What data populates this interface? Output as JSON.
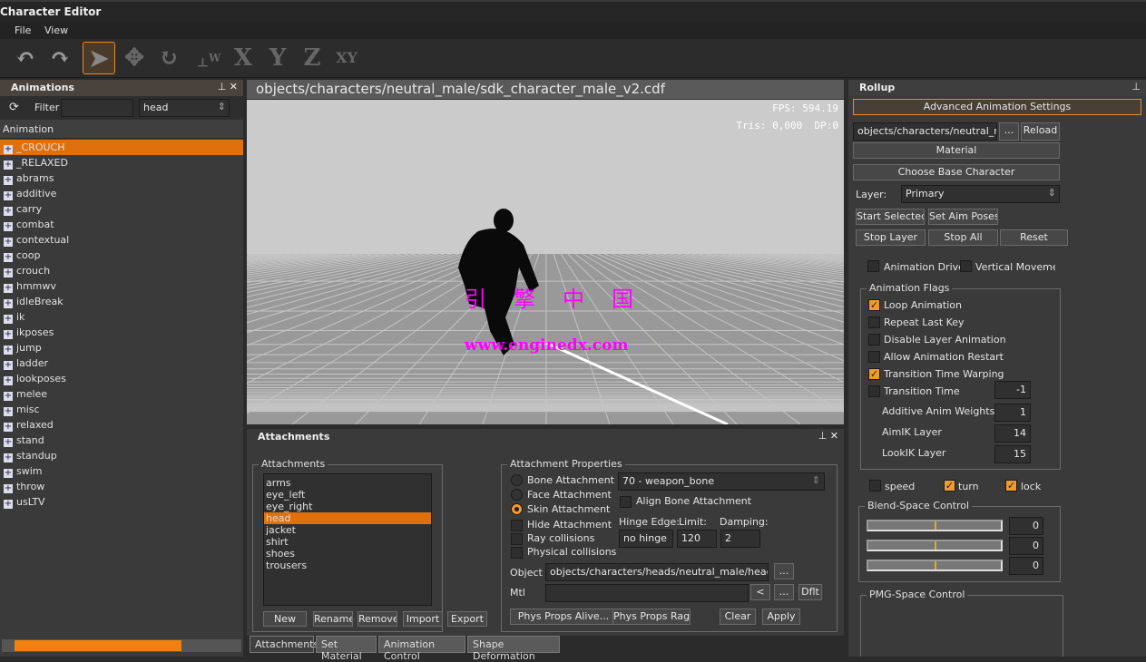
{
  "app": {
    "title": "Character Editor",
    "menu": [
      "File",
      "View"
    ]
  },
  "toolbar": {
    "icons": [
      "undo-icon",
      "redo-icon",
      "select-arrow-icon",
      "move-icon",
      "rotate-icon",
      "world-axis-icon"
    ],
    "axis_buttons": [
      "X",
      "Y",
      "Z",
      "XY"
    ],
    "world_label": "W"
  },
  "animations": {
    "title": "Animations",
    "filter_label": "Filter",
    "filter_value": "",
    "combo_value": "head",
    "column": "Animation",
    "items": [
      "_CROUCH",
      "_RELAXED",
      "abrams",
      "additive",
      "carry",
      "combat",
      "contextual",
      "coop",
      "crouch",
      "hmmwv",
      "idleBreak",
      "ik",
      "ikposes",
      "jump",
      "ladder",
      "lookposes",
      "melee",
      "misc",
      "relaxed",
      "stand",
      "standup",
      "swim",
      "throw",
      "usLTV"
    ],
    "selected": "_CROUCH",
    "scroll_fraction": 0.68
  },
  "viewport": {
    "path": "objects/characters/neutral_male/sdk_character_male_v2.cdf",
    "fps": "FPS: 594.19",
    "tris": "Tris: 0,000  DP:0",
    "watermark_cn": "引擎中国",
    "watermark_url": "www.enginedx.com"
  },
  "attachments": {
    "title": "Attachments",
    "list_title": "Attachments",
    "items": [
      "arms",
      "eye_left",
      "eye_right",
      "head",
      "jacket",
      "shirt",
      "shoes",
      "trousers"
    ],
    "selected": "head",
    "buttons": [
      "New",
      "Rename",
      "Remove",
      "Import",
      "Export"
    ],
    "props": {
      "title": "Attachment Properties",
      "radios": [
        {
          "label": "Bone Attachment",
          "on": false
        },
        {
          "label": "Face Attachment",
          "on": false
        },
        {
          "label": "Skin Attachment",
          "on": true
        }
      ],
      "checks": [
        "Hide Attachment",
        "Ray collisions",
        "Physical collisions"
      ],
      "bone": "70 - weapon_bone",
      "align": "Align Bone Attachment",
      "hinge_label": "Hinge Edge:",
      "hinge": "no hinge",
      "limit_label": "Limit:",
      "limit": "120",
      "damping_label": "Damping:",
      "damping": "2",
      "object_label": "Object",
      "object": "objects/characters/heads/neutral_male/head.chr",
      "browse": "...",
      "mtl_label": "Mtl",
      "mtl": "",
      "lt": "<",
      "dflt": "Dflt",
      "buttons": [
        "Phys Props Alive...",
        "Phys Props Ragdoll...",
        "Clear",
        "Apply"
      ]
    }
  },
  "bottom_tabs": [
    "Attachments",
    "Set Material",
    "Animation Control",
    "Shape Deformation"
  ],
  "rollup": {
    "title": "Rollup",
    "section": "Advanced Animation Settings",
    "path": "objects/characters/neutral_mal",
    "browse": "...",
    "reload": "Reload",
    "material": "Material",
    "choose_base": "Choose Base Character",
    "layer_label": "Layer:",
    "layer": "Primary",
    "buttons": [
      "Start Selected",
      "Set Aim Poses",
      "Stop Layer",
      "Stop All",
      "Reset"
    ],
    "anim_driven": "Animation Driven",
    "vertical": "Vertical Movement",
    "flags_title": "Animation Flags",
    "flags": [
      {
        "label": "Loop Animation",
        "on": true
      },
      {
        "label": "Repeat Last Key",
        "on": false
      },
      {
        "label": "Disable Layer Animation",
        "on": false
      },
      {
        "label": "Allow Animation Restart",
        "on": false
      },
      {
        "label": "Transition Time Warping",
        "on": true
      },
      {
        "label": "Transition Time",
        "on": false
      }
    ],
    "transition_time": "-1",
    "additive_label": "Additive Anim Weights",
    "additive": "1",
    "aimik_label": "AimIK Layer",
    "aimik": "14",
    "lookik_label": "LookIK Layer",
    "lookik": "15",
    "speed": "speed",
    "turn": "turn",
    "lock": "lock",
    "speed_on": false,
    "turn_on": true,
    "lock_on": true,
    "blend_title": "Blend-Space Control",
    "blend_values": [
      "0",
      "0",
      "0"
    ],
    "blend_slider_fraction": 0.5,
    "pmg_title": "PMG-Space Control"
  },
  "colors": {
    "accent": "#e0700c",
    "panel": "#3a3a3a",
    "viewport_bg": "#c8c8c8",
    "watermark": "#ff00ff"
  }
}
